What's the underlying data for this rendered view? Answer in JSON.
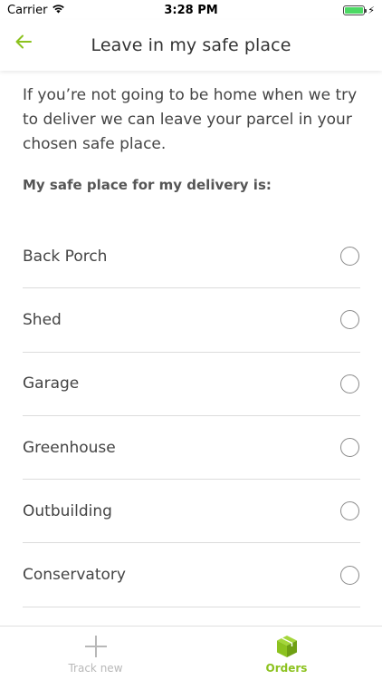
{
  "status_bar": {
    "carrier": "Carrier",
    "time": "3:28 PM",
    "battery_level": 1.0
  },
  "nav": {
    "back_icon": "arrow-left-icon",
    "title": "Leave in my safe place"
  },
  "content": {
    "intro": "If you’re not going to be home when we try to deliver we can leave your parcel in your chosen safe place.",
    "question": "My safe place for my delivery is:"
  },
  "options": [
    {
      "label": "Back Porch",
      "selected": false
    },
    {
      "label": "Shed",
      "selected": false
    },
    {
      "label": "Garage",
      "selected": false
    },
    {
      "label": "Greenhouse",
      "selected": false
    },
    {
      "label": "Outbuilding",
      "selected": false
    },
    {
      "label": "Conservatory",
      "selected": false
    }
  ],
  "tabs": [
    {
      "label": "Track new",
      "icon": "plus-icon",
      "active": false
    },
    {
      "label": "Orders",
      "icon": "package-icon",
      "active": true
    }
  ],
  "colors": {
    "accent": "#8cc21f",
    "inactive": "#b8b8b8"
  }
}
